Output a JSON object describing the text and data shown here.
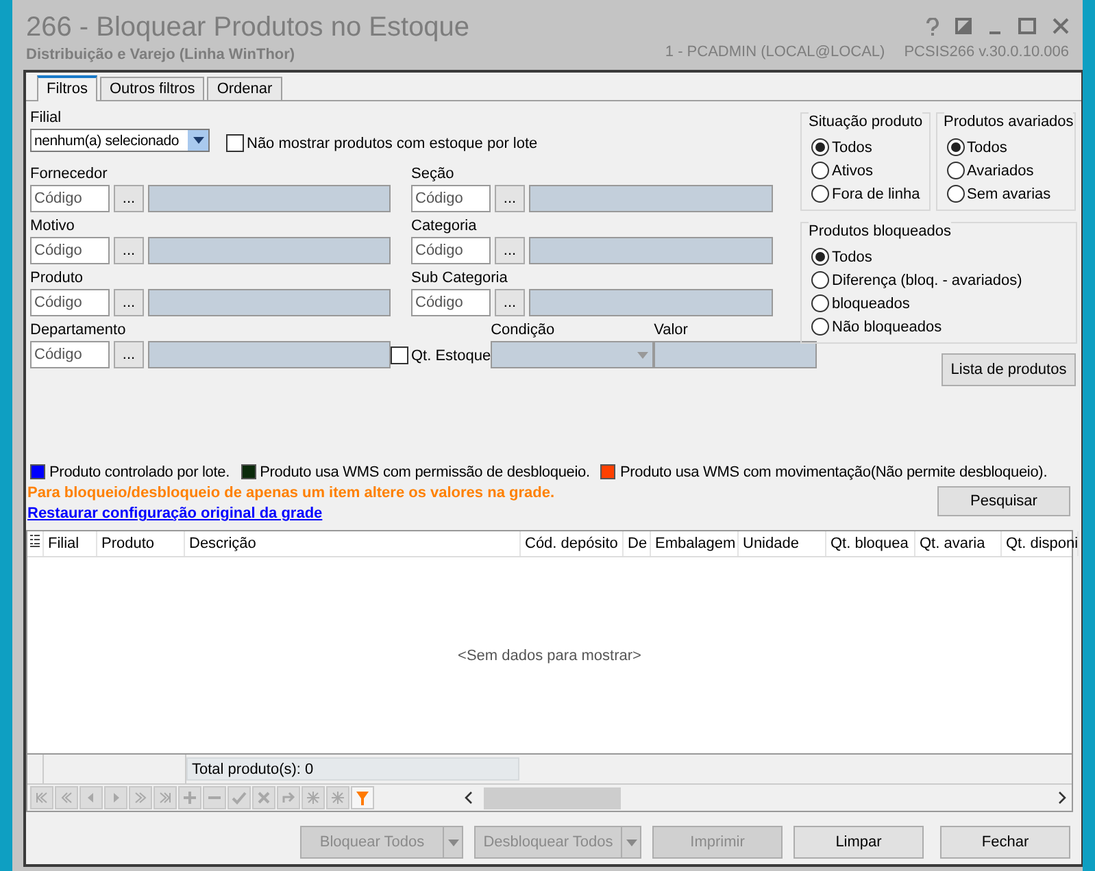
{
  "window": {
    "title": "266 - Bloquear Produtos no Estoque",
    "subtitle": "Distribuição e Varejo (Linha WinThor)",
    "user": "1 - PCADMIN (LOCAL@LOCAL)",
    "program": "PCSIS266",
    "version": "v.30.0.10.006"
  },
  "tabs": [
    {
      "label": "Filtros",
      "selected": true
    },
    {
      "label": "Outros filtros",
      "selected": false
    },
    {
      "label": "Ordenar",
      "selected": false
    }
  ],
  "filial": {
    "label": "Filial",
    "value": "nenhum(a) selecionado"
  },
  "lot_checkbox": {
    "label": "Não mostrar produtos com estoque por lote",
    "checked": false
  },
  "left_lookups": [
    {
      "label": "Fornecedor",
      "placeholder": "Código",
      "button": "..."
    },
    {
      "label": "Motivo",
      "placeholder": "Código",
      "button": "..."
    },
    {
      "label": "Produto",
      "placeholder": "Código",
      "button": "..."
    },
    {
      "label": "Departamento",
      "placeholder": "Código",
      "button": "..."
    }
  ],
  "right_lookups": [
    {
      "label": "Seção",
      "placeholder": "Código",
      "button": "..."
    },
    {
      "label": "Categoria",
      "placeholder": "Código",
      "button": "..."
    },
    {
      "label": "Sub Categoria",
      "placeholder": "Código",
      "button": "..."
    }
  ],
  "qt_estoque": {
    "label": "Qt. Estoque",
    "checked": false
  },
  "condicao": {
    "label": "Condição"
  },
  "valor": {
    "label": "Valor"
  },
  "situacao": {
    "title": "Situação produto",
    "options": [
      {
        "label": "Todos",
        "selected": true
      },
      {
        "label": "Ativos",
        "selected": false
      },
      {
        "label": "Fora de linha",
        "selected": false
      }
    ]
  },
  "avariados": {
    "title": "Produtos avariados",
    "options": [
      {
        "label": "Todos",
        "selected": true
      },
      {
        "label": "Avariados",
        "selected": false
      },
      {
        "label": "Sem avarias",
        "selected": false
      }
    ]
  },
  "bloqueados": {
    "title": "Produtos bloqueados",
    "options": [
      {
        "label": "Todos",
        "selected": true
      },
      {
        "label": "Diferença (bloq. - avariados)",
        "selected": false
      },
      {
        "label": "bloqueados",
        "selected": false
      },
      {
        "label": "Não bloqueados",
        "selected": false
      }
    ]
  },
  "lista_button": "Lista de produtos",
  "legend": [
    {
      "label": "Produto controlado por lote.",
      "color": "#0000ff"
    },
    {
      "label": "Produto usa WMS com permissão de desbloqueio.",
      "color": "#0b2a0b"
    },
    {
      "label": "Produto usa WMS com movimentação(Não permite desbloqueio).",
      "color": "#ff4000"
    }
  ],
  "hint": "Para bloqueio/desbloqueio de apenas um item altere os valores na grade.",
  "restore_link": "Restaurar configuração original da grade",
  "search_button": "Pesquisar",
  "grid": {
    "columns": [
      "Filial",
      "Produto",
      "Descrição",
      "Cód. depósito",
      "De",
      "Embalagem",
      "Unidade",
      "Qt. bloquea",
      "Qt. avaria",
      "Qt. disponi"
    ],
    "empty": "<Sem dados para mostrar>",
    "total": "Total produto(s): 0"
  },
  "buttons": [
    {
      "label": "Bloquear Todos",
      "disabled": true,
      "split": true
    },
    {
      "label": "Desbloquear Todos",
      "disabled": true,
      "split": true
    },
    {
      "label": "Imprimir",
      "disabled": true,
      "split": false
    },
    {
      "label": "Limpar",
      "disabled": false,
      "split": false
    },
    {
      "label": "Fechar",
      "disabled": false,
      "split": false
    }
  ]
}
